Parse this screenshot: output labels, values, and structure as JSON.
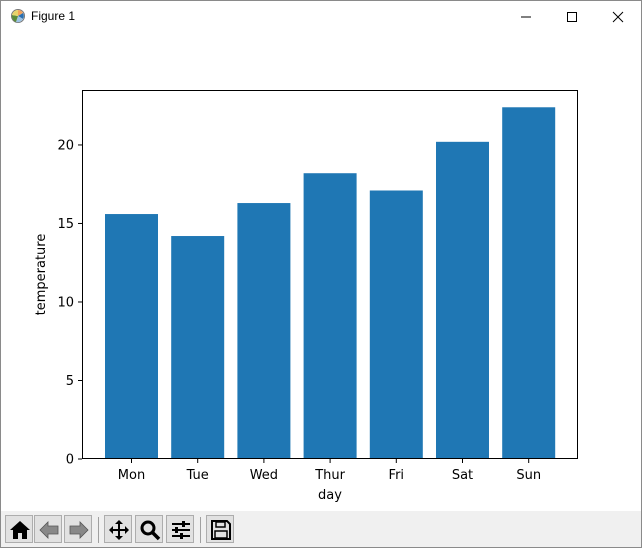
{
  "window": {
    "title": "Figure 1"
  },
  "chart_data": {
    "type": "bar",
    "categories": [
      "Mon",
      "Tue",
      "Wed",
      "Thur",
      "Fri",
      "Sat",
      "Sun"
    ],
    "values": [
      15.6,
      14.2,
      16.3,
      18.2,
      17.1,
      20.2,
      22.4
    ],
    "xlabel": "day",
    "ylabel": "temperature",
    "ylim": [
      0,
      23.5
    ],
    "yticks": [
      0,
      5,
      10,
      15,
      20
    ],
    "bar_color": "#1f77b4",
    "grid": false
  },
  "toolbar": {
    "buttons": [
      "home-icon",
      "back-icon",
      "forward-icon",
      "pan-icon",
      "zoom-icon",
      "subplots-icon",
      "save-icon"
    ]
  }
}
